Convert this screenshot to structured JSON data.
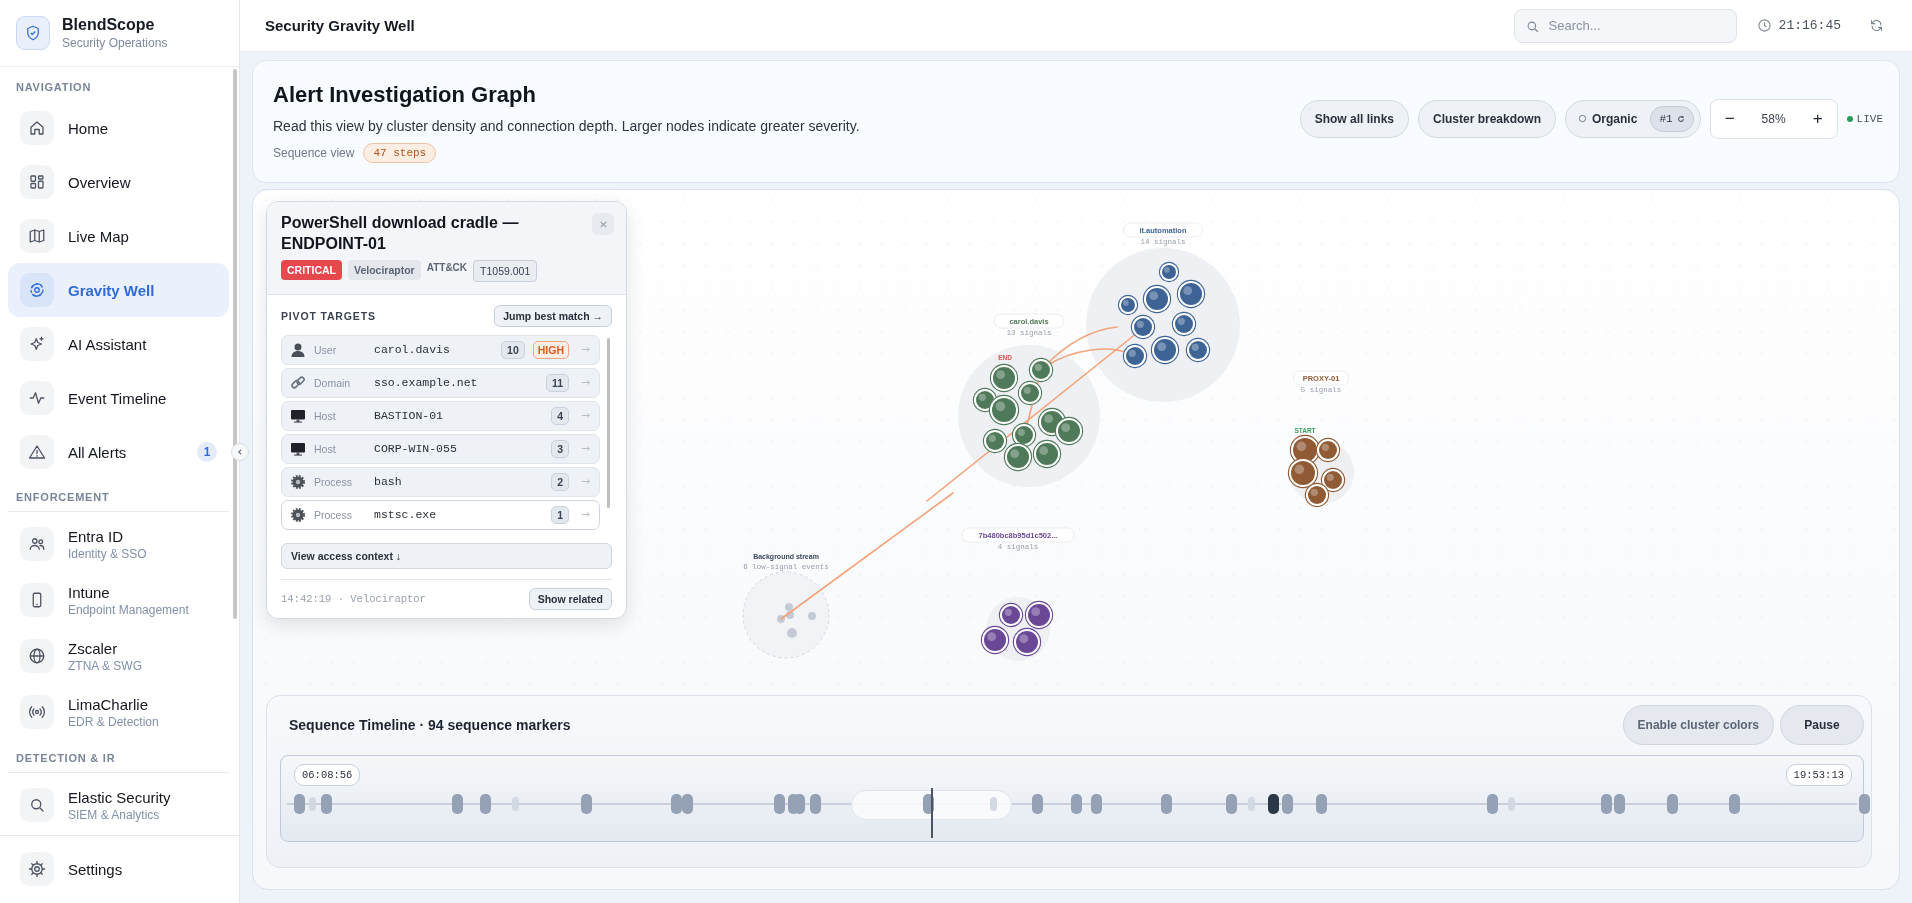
{
  "sidebar": {
    "brand": {
      "name": "BlendScope",
      "subtitle": "Security Operations"
    },
    "sections": [
      {
        "title": "NAVIGATION",
        "items": [
          {
            "label": "Home",
            "selected": false
          },
          {
            "label": "Overview",
            "selected": false
          },
          {
            "label": "Live Map",
            "selected": false
          },
          {
            "label": "Gravity Well",
            "selected": true
          },
          {
            "label": "AI Assistant",
            "selected": false
          },
          {
            "label": "Event Timeline",
            "selected": false
          },
          {
            "label": "All Alerts",
            "selected": false,
            "badge": "1"
          }
        ]
      },
      {
        "title": "ENFORCEMENT",
        "items": [
          {
            "label": "Entra ID",
            "sublabel": "Identity & SSO",
            "selected": false
          },
          {
            "label": "Intune",
            "sublabel": "Endpoint Management",
            "selected": false
          },
          {
            "label": "Zscaler",
            "sublabel": "ZTNA & SWG",
            "selected": false
          },
          {
            "label": "LimaCharlie",
            "sublabel": "EDR & Detection",
            "selected": false
          }
        ]
      },
      {
        "title": "DETECTION & IR",
        "items": [
          {
            "label": "Elastic Security",
            "sublabel": "SIEM & Analytics",
            "selected": false
          }
        ]
      }
    ],
    "footer": {
      "label": "Settings"
    }
  },
  "header": {
    "title": "Security Gravity Well",
    "search": {
      "placeholder": "Search..."
    },
    "clock": "21:16:45"
  },
  "overview": {
    "title": "Alert Investigation Graph",
    "description": "Read this view by cluster density and connection depth. Larger nodes indicate greater severity.",
    "sequence_label": "Sequence view",
    "sequence_badge": "47 steps",
    "actions": [
      "Show all links",
      "Cluster breakdown"
    ],
    "layout": {
      "label": "Organic",
      "badge": "#1"
    },
    "zoom": {
      "minus": "−",
      "value": "58%",
      "plus": "+"
    },
    "live": "LIVE"
  },
  "graph": {
    "clusters": [
      {
        "label": "carol.davis",
        "subtitle": "13 signals",
        "color": "#4f7a59",
        "marker": {
          "text": "END",
          "kind": "end"
        }
      },
      {
        "label": "it.automation",
        "subtitle": "14 signals",
        "color": "#3e6496"
      },
      {
        "label": "PROXY-01",
        "subtitle": "5 signals",
        "color": "#8f5a34",
        "marker": {
          "text": "START",
          "kind": "start"
        }
      },
      {
        "label": "7b480bc8b95d1c502...",
        "subtitle": "4 signals",
        "color": "#6a4896"
      }
    ],
    "background": {
      "label": "Background stream",
      "subtitle": "6 low-signal events"
    }
  },
  "alert_panel": {
    "title": "PowerShell download cradle — ENDPOINT-01",
    "severity": "CRITICAL",
    "source": "Velociraptor",
    "attack_label": "ATT&CK",
    "technique": "T1059.001",
    "section_title": "PIVOT TARGETS",
    "jump_button": "Jump best match →",
    "targets": [
      {
        "kind": "user",
        "type": "User",
        "value": "carol.davis",
        "count": "10",
        "risk": "HIGH",
        "selected": false
      },
      {
        "kind": "domain",
        "type": "Domain",
        "value": "sso.example.net",
        "count": "11",
        "selected": false
      },
      {
        "kind": "host",
        "type": "Host",
        "value": "BASTION-01",
        "count": "4",
        "selected": false
      },
      {
        "kind": "host",
        "type": "Host",
        "value": "CORP-WIN-055",
        "count": "3",
        "selected": false
      },
      {
        "kind": "process",
        "type": "Process",
        "value": "bash",
        "count": "2",
        "selected": false
      },
      {
        "kind": "process",
        "type": "Process",
        "value": "mstsc.exe",
        "count": "1",
        "selected": true
      }
    ],
    "context_button": "View access context ↓",
    "footer_text": "14:42:19 · Velociraptor",
    "footer_button": "Show related"
  },
  "timeline": {
    "title": "Sequence Timeline · 94 sequence markers",
    "buttons": [
      "Enable cluster colors",
      "Pause"
    ],
    "start": "06:08:56",
    "end": "19:53:13",
    "markers": [
      {
        "selected": false,
        "dimmed": false
      },
      {
        "selected": false,
        "dimmed": true
      },
      {
        "selected": false,
        "dimmed": false
      },
      {
        "selected": false,
        "dimmed": false
      },
      {
        "selected": false,
        "dimmed": false
      },
      {
        "selected": false,
        "dimmed": true
      },
      {
        "selected": false,
        "dimmed": false
      },
      {
        "selected": false,
        "dimmed": false
      },
      {
        "selected": false,
        "dimmed": false
      },
      {
        "selected": false,
        "dimmed": false
      },
      {
        "selected": false,
        "dimmed": false
      },
      {
        "selected": false,
        "dimmed": false
      },
      {
        "selected": false,
        "dimmed": false
      },
      {
        "selected": false,
        "dimmed": false
      },
      {
        "selected": false,
        "dimmed": true
      },
      {
        "selected": false,
        "dimmed": false
      },
      {
        "selected": false,
        "dimmed": false
      },
      {
        "selected": false,
        "dimmed": false
      },
      {
        "selected": false,
        "dimmed": false
      },
      {
        "selected": false,
        "dimmed": false
      },
      {
        "selected": false,
        "dimmed": true
      },
      {
        "selected": true,
        "dimmed": false
      },
      {
        "selected": false,
        "dimmed": false
      },
      {
        "selected": false,
        "dimmed": false
      },
      {
        "selected": false,
        "dimmed": false
      },
      {
        "selected": false,
        "dimmed": true
      },
      {
        "selected": false,
        "dimmed": false
      },
      {
        "selected": false,
        "dimmed": false
      },
      {
        "selected": false,
        "dimmed": false
      },
      {
        "selected": false,
        "dimmed": false
      },
      {
        "selected": false,
        "dimmed": false
      }
    ]
  }
}
